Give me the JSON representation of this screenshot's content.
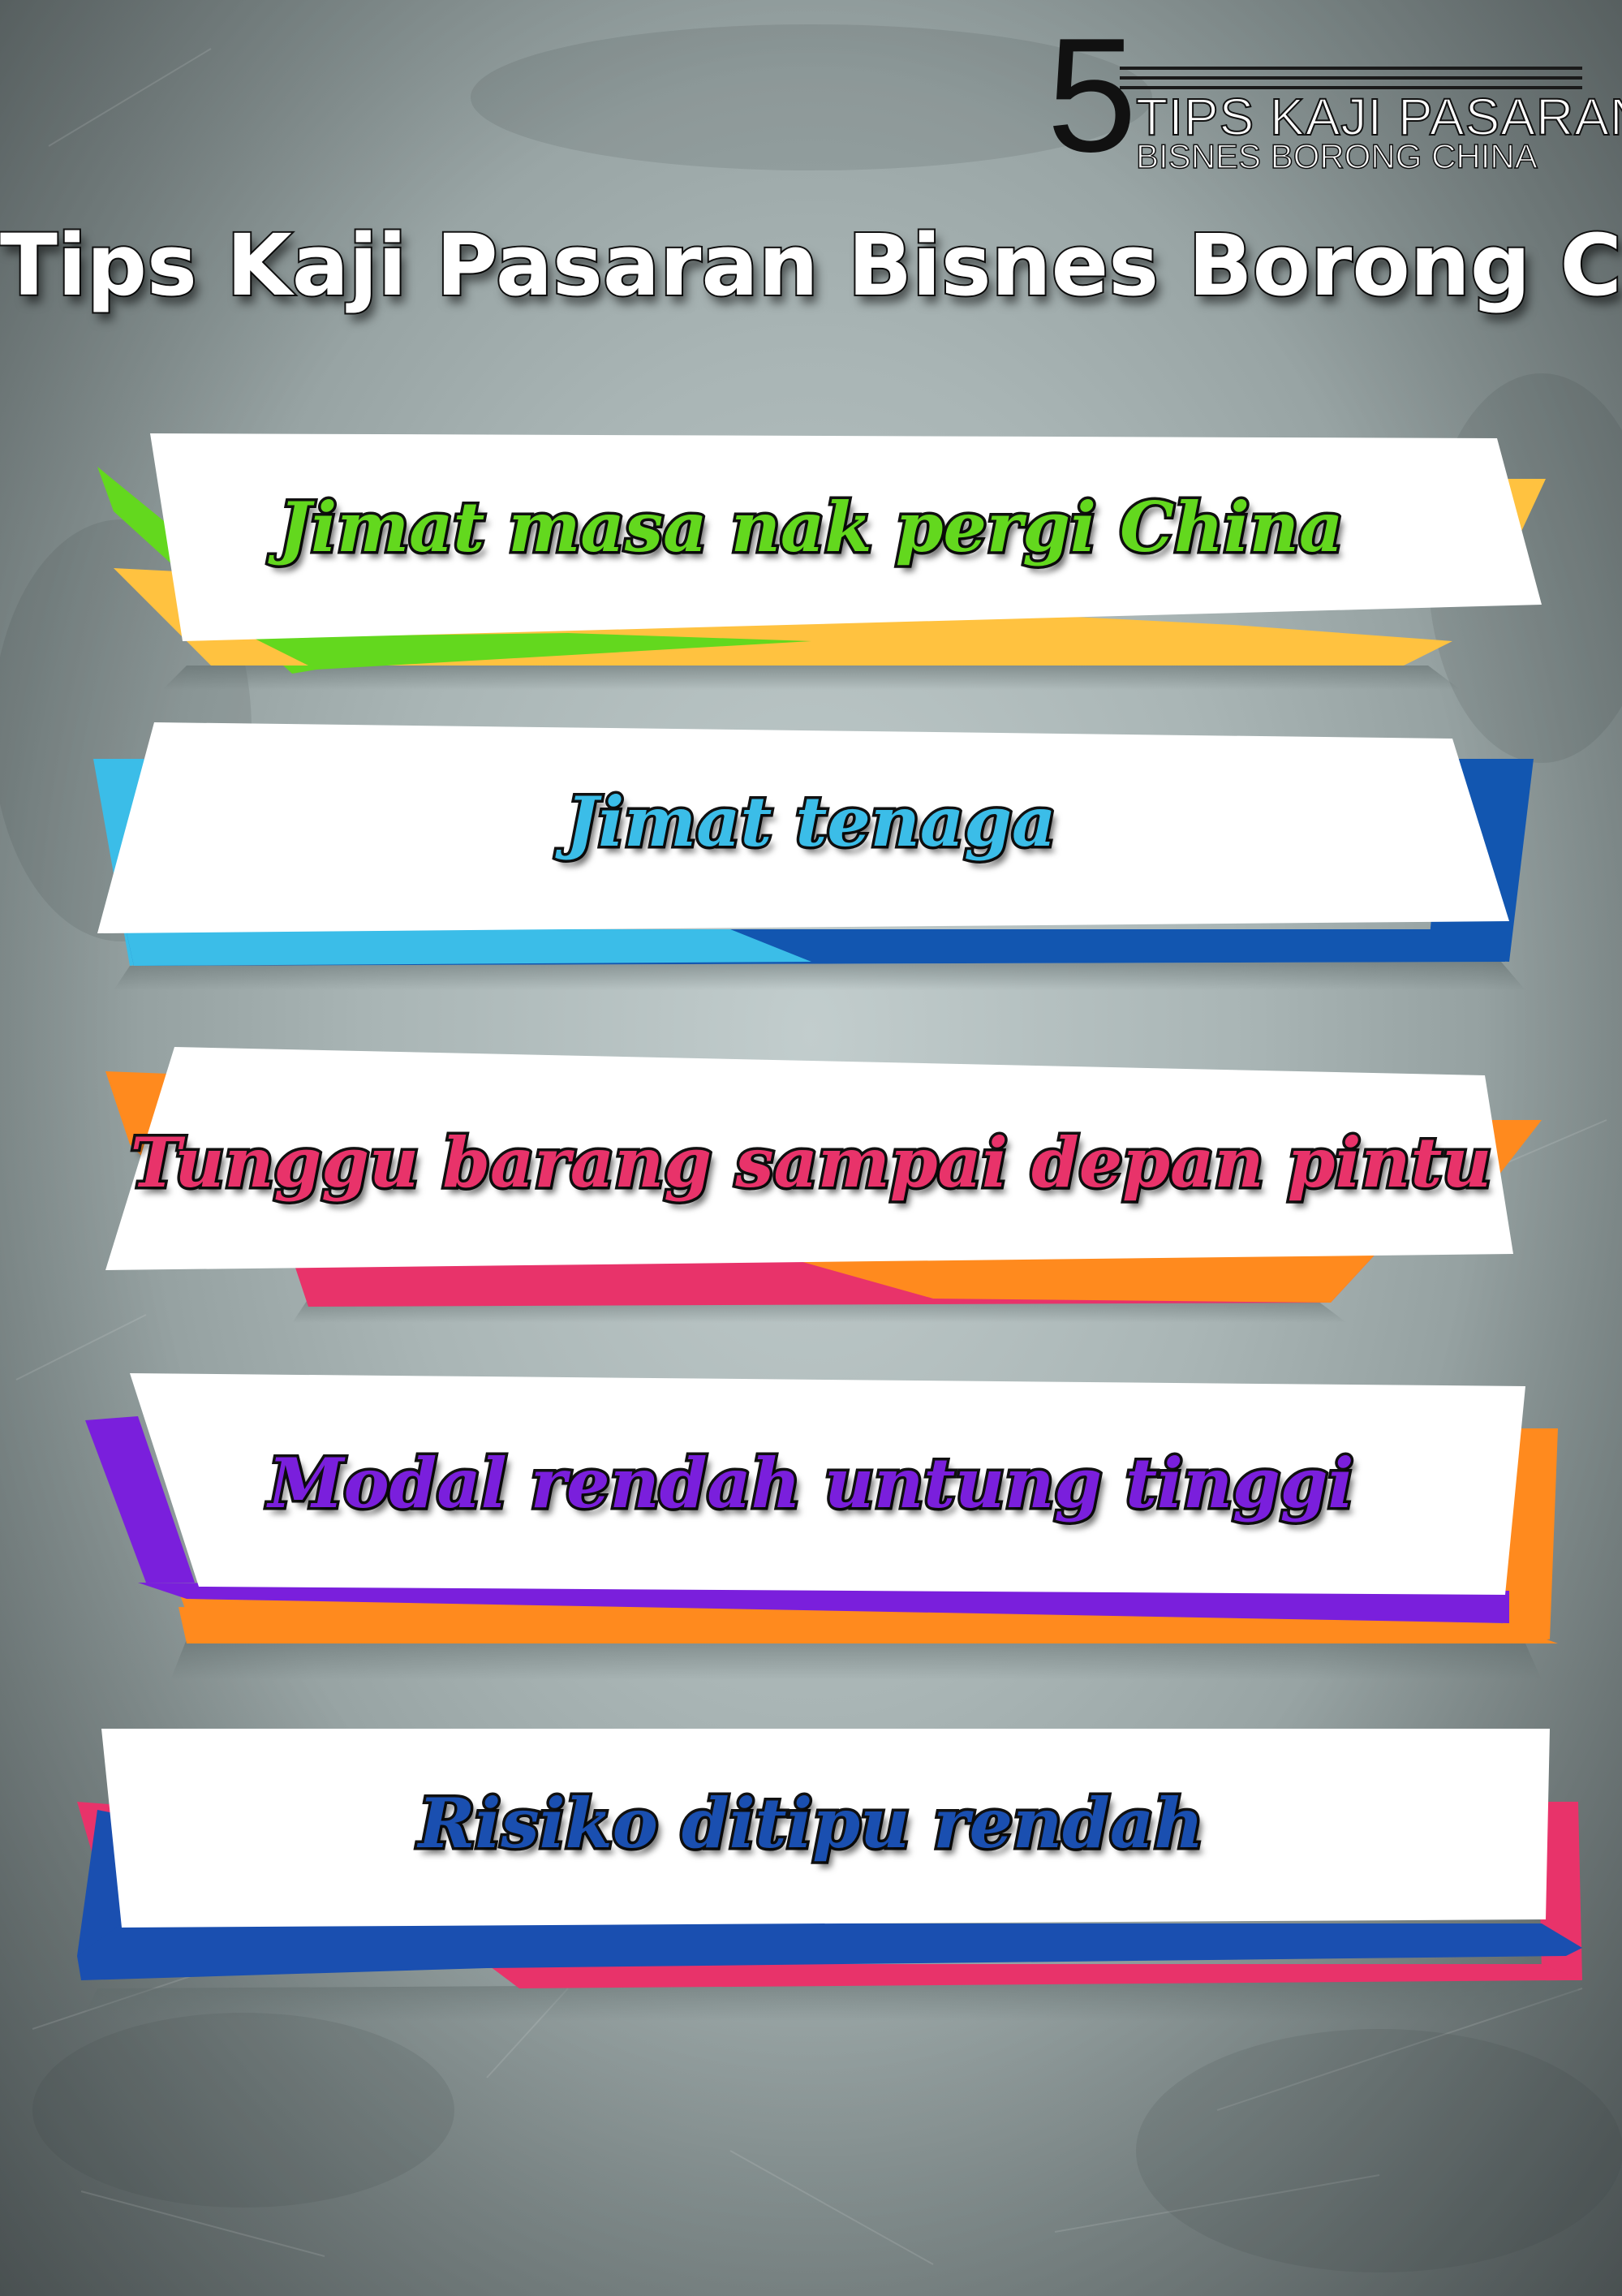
{
  "logo": {
    "number": "5",
    "line1": "TIPS KAJI PASARAN",
    "line2": "BISNES BORONG CHINA"
  },
  "title": "Tips Kaji Pasaran Bisnes Borong China",
  "tips": [
    {
      "text": "Jimat masa nak pergi China",
      "text_color": "#63d81e",
      "accent_colors": [
        "#63d81e",
        "#ffc240"
      ]
    },
    {
      "text": "Jimat tenaga",
      "text_color": "#3bbde8",
      "accent_colors": [
        "#3bbde8",
        "#1256b0"
      ]
    },
    {
      "text": "Tunggu barang sampai depan pintu",
      "text_color": "#e8336a",
      "accent_colors": [
        "#ff8a1e",
        "#e8336a"
      ]
    },
    {
      "text": "Modal rendah untung tinggi",
      "text_color": "#7a1fdc",
      "accent_colors": [
        "#7a1fdc",
        "#ff8a1e"
      ]
    },
    {
      "text": "Risiko ditipu rendah",
      "text_color": "#1a4fb0",
      "accent_colors": [
        "#e8336a",
        "#1a4fb0"
      ]
    }
  ],
  "background_color": "#a9b5b5"
}
